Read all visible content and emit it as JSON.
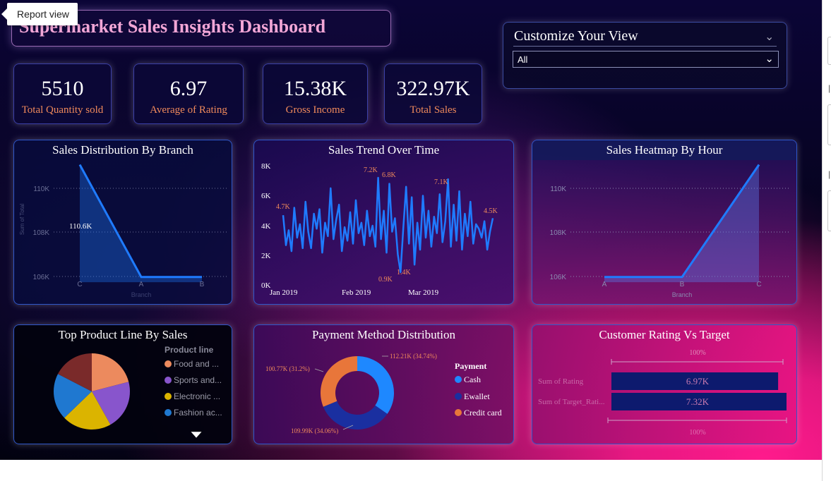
{
  "tooltip": "Report view",
  "title": "Supermarket Sales Insights Dashboard",
  "slicer": {
    "title": "Customize Your View",
    "selected": "All"
  },
  "kpis": [
    {
      "value": "5510",
      "label": "Total Quantity sold"
    },
    {
      "value": "6.97",
      "label": "Average of Rating"
    },
    {
      "value": "15.38K",
      "label": "Gross Income"
    },
    {
      "value": "322.97K",
      "label": "Total Sales"
    }
  ],
  "branch_chart": {
    "title": "Sales Distribution By Branch",
    "xlabel": "Branch",
    "ylabel": "Sum of Total",
    "yticks": [
      "110K",
      "108K",
      "106K"
    ],
    "categories": [
      "C",
      "A",
      "B"
    ],
    "data_label": "110.6K"
  },
  "trend_chart": {
    "title": "Sales Trend Over Time",
    "yticks": [
      "8K",
      "6K",
      "4K",
      "2K",
      "0K"
    ],
    "xticks": [
      "Jan 2019",
      "Feb 2019",
      "Mar 2019"
    ],
    "labels": [
      "7.2K",
      "6.8K",
      "7.1K",
      "4.7K",
      "4.5K",
      "1.4K",
      "0.9K"
    ]
  },
  "heatmap_chart": {
    "title": "Sales Heatmap By Hour",
    "xlabel": "Branch",
    "yticks": [
      "110K",
      "108K",
      "106K"
    ],
    "categories": [
      "A",
      "B",
      "C"
    ]
  },
  "product_chart": {
    "title": "Top Product Line By Sales",
    "legend_title": "Product line",
    "legend": [
      "Food and ...",
      "Sports and...",
      "Electronic ...",
      "Fashion ac..."
    ]
  },
  "payment_chart": {
    "title": "Payment Method Distribution",
    "legend_title": "Payment",
    "legend": [
      "Cash",
      "Ewallet",
      "Credit card"
    ],
    "labels": [
      "112.21K (34.74%)",
      "100.77K (31.2%)",
      "109.99K (34.06%)"
    ]
  },
  "rating_chart": {
    "title": "Customer Rating Vs Target",
    "rows": [
      "Sum of Rating",
      "Sum of Target_Rati..."
    ],
    "values": [
      "6.97K",
      "7.32K"
    ],
    "pct_top": "100%",
    "pct_bottom": "100%"
  },
  "colors": {
    "accent_blue": "#1f7bff",
    "kpi_label": "#f08a5b",
    "title_pink": "#f2a6d6",
    "pie": [
      "#ec8a5e",
      "#8855cc",
      "#dbb400",
      "#1f78d0",
      "#7a2a2a"
    ],
    "donut": [
      "#1e88ff",
      "#1a2fa0",
      "#e8763a"
    ],
    "bar": "#0d1a6e"
  },
  "chart_data": [
    {
      "type": "area",
      "title": "Sales Distribution By Branch",
      "categories": [
        "C",
        "A",
        "B"
      ],
      "values": [
        110.6,
        106.2,
        106.2
      ],
      "ylim": [
        105.5,
        111
      ],
      "unit": "K"
    },
    {
      "type": "line",
      "title": "Sales Trend Over Time",
      "x": [
        "Jan 2019",
        "Feb 2019",
        "Mar 2019"
      ],
      "values": [
        4.7,
        2.7,
        3.7,
        2.3,
        5.2,
        3.2,
        4.1,
        2.5,
        5.6,
        3.6,
        2.5,
        4.8,
        3.8,
        5.1,
        2.2,
        4.2,
        3.3,
        6.5,
        3.1,
        4.4,
        5.4,
        2.3,
        3.9,
        3.0,
        4.9,
        2.8,
        5.7,
        3.5,
        4.2,
        2.7,
        5.0,
        3.3,
        4.0,
        2.6,
        7.2,
        3.1,
        5.0,
        2.2,
        6.8,
        3.6,
        4.5,
        2.1,
        0.9,
        3.9,
        6.6,
        2.8,
        5.9,
        1.4,
        4.2,
        2.4,
        6.0,
        3.2,
        5.0,
        2.6,
        4.6,
        3.5,
        6.1,
        2.9,
        4.3,
        7.1,
        2.6,
        5.4,
        3.0,
        6.3,
        2.4,
        4.8,
        3.3,
        5.6,
        2.8,
        4.1,
        3.8,
        3.2,
        4.3,
        2.4,
        3.6,
        4.5
      ],
      "ylim": [
        0,
        8
      ],
      "unit": "K"
    },
    {
      "type": "area",
      "title": "Sales Heatmap By Hour",
      "categories": [
        "A",
        "B",
        "C"
      ],
      "values": [
        106.2,
        106.2,
        110.6
      ],
      "ylim": [
        105.5,
        111
      ],
      "unit": "K"
    },
    {
      "type": "pie",
      "title": "Top Product Line By Sales",
      "categories": [
        "Food and ...",
        "Sports and...",
        "Electronic ...",
        "Fashion ac...",
        ""
      ],
      "values": [
        18,
        18,
        18,
        17,
        15
      ]
    },
    {
      "type": "pie",
      "title": "Payment Method Distribution",
      "categories": [
        "Cash",
        "Ewallet",
        "Credit card"
      ],
      "values": [
        112.21,
        109.99,
        100.77
      ],
      "unit": "K"
    },
    {
      "type": "bar",
      "title": "Customer Rating Vs Target",
      "categories": [
        "Sum of Rating",
        "Sum of Target_Rati..."
      ],
      "values": [
        6.97,
        7.32
      ],
      "unit": "K"
    }
  ]
}
